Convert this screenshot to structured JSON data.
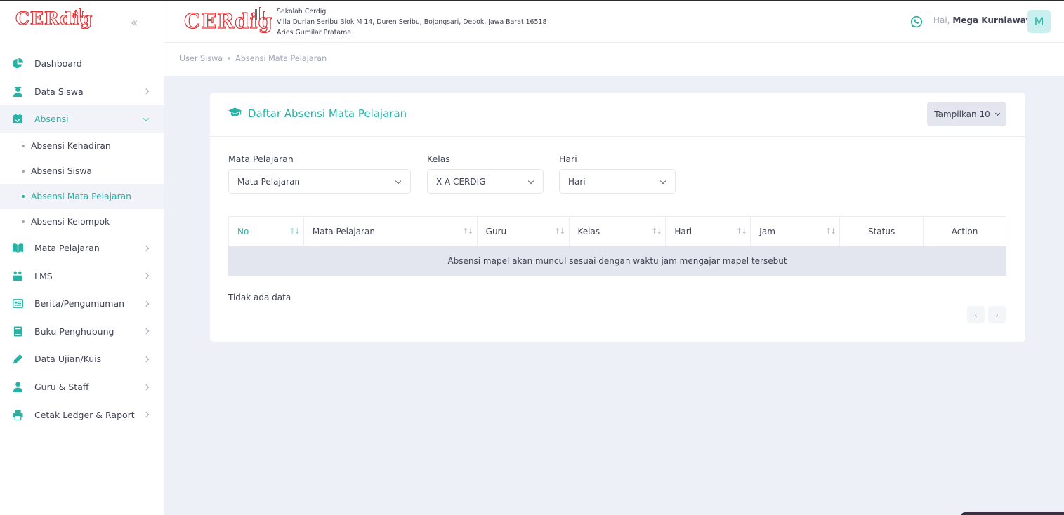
{
  "brand": {
    "logo_text": "CERdig",
    "accent": "#26b3a5",
    "logo_color": "#e0353a"
  },
  "sidebar": {
    "items": [
      {
        "label": "Dashboard",
        "icon": "pie-chart-icon"
      },
      {
        "label": "Data Siswa",
        "icon": "student-icon"
      },
      {
        "label": "Absensi",
        "icon": "calendar-check-icon"
      },
      {
        "label": "Mata Pelajaran",
        "icon": "book-open-icon"
      },
      {
        "label": "LMS",
        "icon": "lms-icon"
      },
      {
        "label": "Berita/Pengumuman",
        "icon": "newspaper-icon"
      },
      {
        "label": "Buku Penghubung",
        "icon": "book-icon"
      },
      {
        "label": "Data Ujian/Kuis",
        "icon": "pencil-icon"
      },
      {
        "label": "Guru & Staff",
        "icon": "teacher-icon"
      },
      {
        "label": "Cetak Ledger & Raport",
        "icon": "printer-icon"
      }
    ],
    "absensi_sub": [
      {
        "label": "Absensi Kehadiran"
      },
      {
        "label": "Absensi Siswa"
      },
      {
        "label": "Absensi Mata Pelajaran"
      },
      {
        "label": "Absensi Kelompok"
      }
    ]
  },
  "header": {
    "school_name": "Sekolah Cerdig",
    "school_address": "Villa Durian Seribu Blok M 14, Duren Seribu, Bojongsari, Depok, Jawa Barat 16518",
    "principal": "Aries Gumilar Pratama",
    "greeting": "Hai,",
    "user_name": "Mega Kurniawati",
    "avatar_initial": "M"
  },
  "breadcrumb": [
    "User Siswa",
    "Absensi Mata Pelajaran"
  ],
  "card": {
    "title": "Daftar Absensi Mata Pelajaran",
    "show_label": "Tampilkan 10"
  },
  "filters": {
    "mapel": {
      "label": "Mata Pelajaran",
      "value": "Mata Pelajaran"
    },
    "kelas": {
      "label": "Kelas",
      "value": "X A CERDIG"
    },
    "hari": {
      "label": "Hari",
      "value": "Hari"
    }
  },
  "table": {
    "columns": [
      "No",
      "Mata Pelajaran",
      "Guru",
      "Kelas",
      "Hari",
      "Jam",
      "Status",
      "Action"
    ],
    "empty_message": "Absensi mapel akan muncul sesuai dengan waktu jam mengajar mapel tersebut"
  },
  "no_data_text": "Tidak ada data",
  "pagination": {
    "prev": "‹",
    "next": "›"
  },
  "sort_glyph": "↑↓"
}
